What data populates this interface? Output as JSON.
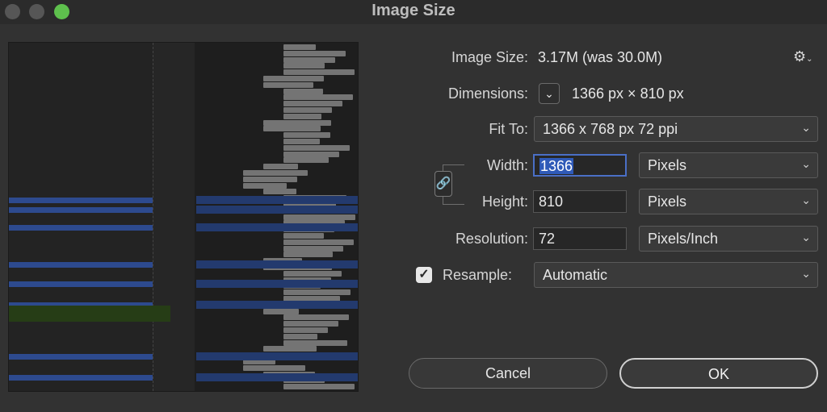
{
  "window": {
    "title": "Image Size"
  },
  "info": {
    "image_size_label": "Image Size:",
    "image_size_value": "3.17M (was 30.0M)",
    "dimensions_label": "Dimensions:",
    "dimensions_value": "1366 px × 810 px"
  },
  "fit_to": {
    "label": "Fit To:",
    "selected": "1366 x 768 px 72 ppi"
  },
  "width": {
    "label": "Width:",
    "value": "1366",
    "unit": "Pixels"
  },
  "height": {
    "label": "Height:",
    "value": "810",
    "unit": "Pixels"
  },
  "resolution": {
    "label": "Resolution:",
    "value": "72",
    "unit": "Pixels/Inch"
  },
  "resample": {
    "label": "Resample:",
    "checked": true,
    "selected": "Automatic"
  },
  "buttons": {
    "cancel": "Cancel",
    "ok": "OK"
  },
  "icons": {
    "settings": "gear-icon",
    "link": "chain-link-icon",
    "dimensions_toggle": "chevron-down-icon"
  },
  "colors": {
    "accent": "#4a6fc6",
    "zoom_button": "#5ec04d"
  }
}
